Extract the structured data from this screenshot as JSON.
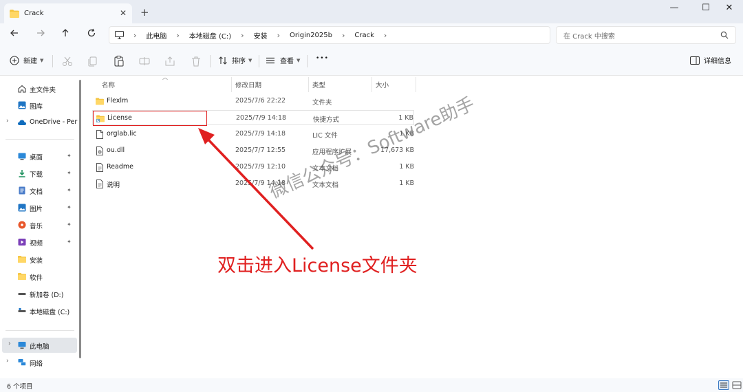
{
  "window": {
    "tab_title": "Crack",
    "close_symbol": "✕",
    "new_tab_symbol": "+",
    "minimize_symbol": "—",
    "maximize_symbol": "☐",
    "close_window_symbol": "✕"
  },
  "nav": {
    "back_icon": "arrow-left-icon",
    "forward_icon": "arrow-right-icon",
    "up_icon": "arrow-up-icon",
    "refresh_icon": "refresh-icon",
    "breadcrumbs": [
      "此电脑",
      "本地磁盘 (C:)",
      "安装",
      "Origin2025b",
      "Crack"
    ],
    "search_placeholder": "在 Crack 中搜索"
  },
  "toolbar": {
    "new_label": "新建",
    "sort_label": "排序",
    "view_label": "查看",
    "more_label": "•••",
    "details_label": "详细信息"
  },
  "sidebar": {
    "quick": [
      {
        "label": "主文件夹",
        "icon": "home-icon"
      },
      {
        "label": "图库",
        "icon": "gallery-icon"
      },
      {
        "label": "OneDrive - Per",
        "icon": "cloud-icon"
      }
    ],
    "pinned": [
      {
        "label": "桌面",
        "icon": "desktop-icon"
      },
      {
        "label": "下载",
        "icon": "download-icon"
      },
      {
        "label": "文档",
        "icon": "document-icon"
      },
      {
        "label": "图片",
        "icon": "picture-icon"
      },
      {
        "label": "音乐",
        "icon": "music-icon"
      },
      {
        "label": "视频",
        "icon": "video-icon"
      },
      {
        "label": "安装",
        "icon": "folder-icon"
      },
      {
        "label": "软件",
        "icon": "folder-icon"
      },
      {
        "label": "新加卷 (D:)",
        "icon": "drive-icon"
      },
      {
        "label": "本地磁盘 (C:)",
        "icon": "drive-icon"
      }
    ],
    "bottom": [
      {
        "label": "此电脑",
        "icon": "computer-icon"
      },
      {
        "label": "网络",
        "icon": "network-icon"
      }
    ],
    "pin_symbol": "📌"
  },
  "columns": {
    "name": "名称",
    "modified": "修改日期",
    "type": "类型",
    "size": "大小"
  },
  "files": [
    {
      "name": "Flexlm",
      "date": "2025/7/6 22:22",
      "type": "文件夹",
      "size": "",
      "icon": "folder-icon"
    },
    {
      "name": "License",
      "date": "2025/7/9 14:18",
      "type": "快捷方式",
      "size": "1 KB",
      "icon": "folder-shortcut-icon"
    },
    {
      "name": "orglab.lic",
      "date": "2025/7/9 14:18",
      "type": "LIC 文件",
      "size": "1 KB",
      "icon": "file-icon"
    },
    {
      "name": "ou.dll",
      "date": "2025/7/7 12:55",
      "type": "应用程序扩展",
      "size": "17,673 KB",
      "icon": "dll-icon"
    },
    {
      "name": "Readme",
      "date": "2025/7/9 12:10",
      "type": "文本文档",
      "size": "1 KB",
      "icon": "text-file-icon"
    },
    {
      "name": "说明",
      "date": "2025/7/9 14:18",
      "type": "文本文档",
      "size": "1 KB",
      "icon": "text-file-icon"
    }
  ],
  "status": {
    "item_count": "6 个项目"
  },
  "annotation": {
    "text": "双击进入License文件夹",
    "color": "#e02020"
  },
  "watermark": {
    "text": "微信公众号：Software助手"
  },
  "colors": {
    "folder": "#f4c542",
    "accent": "#0067c0",
    "annotation": "#e02020"
  }
}
